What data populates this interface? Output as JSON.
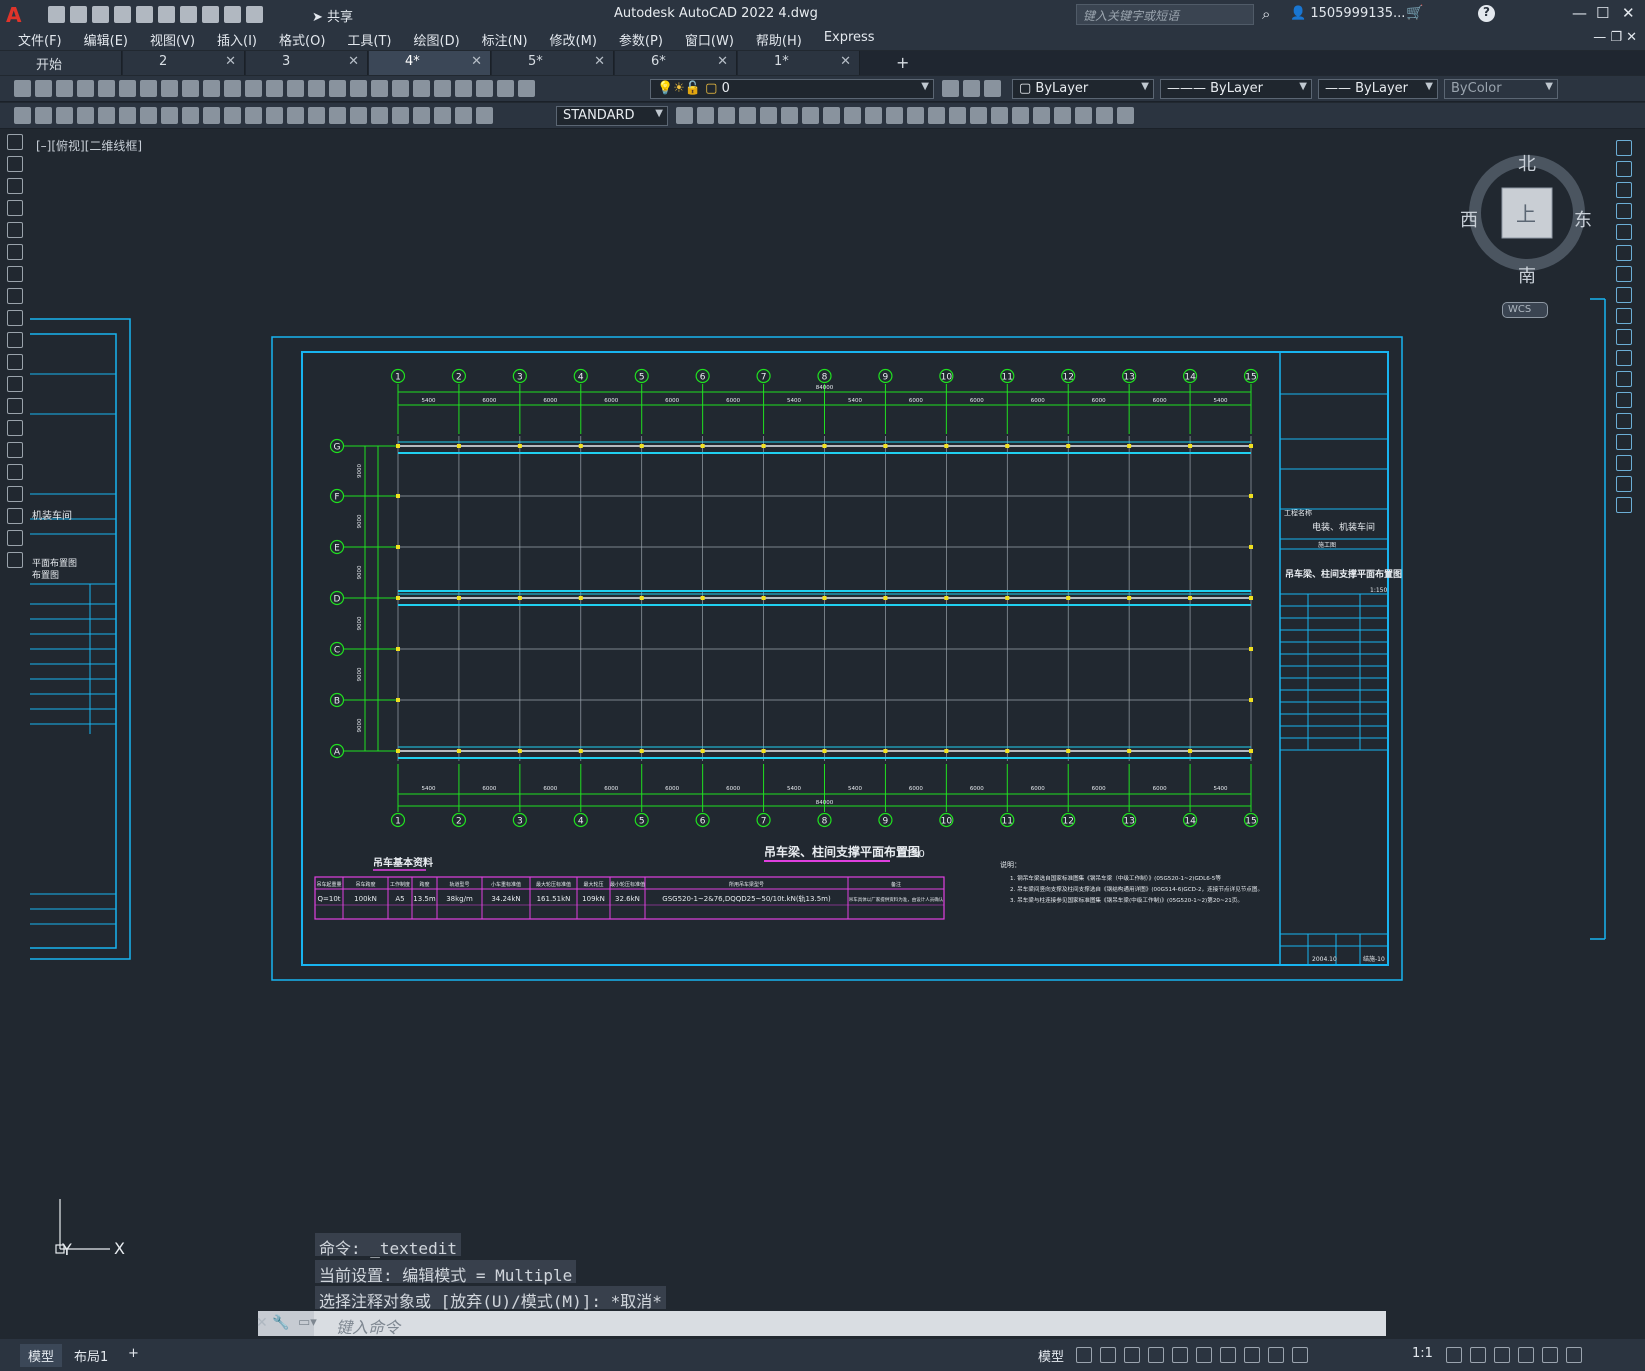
{
  "app": {
    "logo": "A",
    "share": "共享",
    "title": "Autodesk AutoCAD 2022    4.dwg",
    "search_placeholder": "键入关键字或短语",
    "user": "1505999135...",
    "minimize": "—",
    "maximize": "☐",
    "close": "✕"
  },
  "menu": [
    "文件(F)",
    "编辑(E)",
    "视图(V)",
    "插入(I)",
    "格式(O)",
    "工具(T)",
    "绘图(D)",
    "标注(N)",
    "修改(M)",
    "参数(P)",
    "窗口(W)",
    "帮助(H)",
    "Express"
  ],
  "tabs": [
    {
      "label": "开始",
      "close": ""
    },
    {
      "label": "2",
      "close": "✕"
    },
    {
      "label": "3",
      "close": "✕"
    },
    {
      "label": "4*",
      "close": "✕"
    },
    {
      "label": "5*",
      "close": "✕"
    },
    {
      "label": "6*",
      "close": "✕"
    },
    {
      "label": "1*",
      "close": "✕"
    }
  ],
  "tab_add": "+",
  "layers": {
    "current_layer": "0",
    "color": "ByLayer",
    "linetype": "ByLayer",
    "lineweight": "ByLayer",
    "plotstyle": "ByColor"
  },
  "text_style": "STANDARD",
  "view_label": "[–][俯视][二维线框]",
  "compass": {
    "north": "北",
    "south": "南",
    "east": "东",
    "west": "西",
    "top": "上",
    "wcs": "WCS"
  },
  "ucs": {
    "y": "Y",
    "x": "X"
  },
  "drawing": {
    "title": "吊车梁、柱间支撑平面布置图",
    "scale": "1:150",
    "crane_table_title": "吊车基本资料",
    "axes_numbers": [
      "1",
      "2",
      "3",
      "4",
      "5",
      "6",
      "7",
      "8",
      "9",
      "10",
      "11",
      "12",
      "13",
      "14",
      "15"
    ],
    "axes_letters": [
      "G",
      "F",
      "E",
      "D",
      "C",
      "B",
      "A"
    ],
    "spans": [
      "5400",
      "6000",
      "6000",
      "6000",
      "6000",
      "6000",
      "5400",
      "5400",
      "6000",
      "6000",
      "6000",
      "6000",
      "6000",
      "5400"
    ],
    "total_length": "84000",
    "row_spacing": [
      "9000",
      "9000",
      "9000",
      "9000",
      "9000",
      "9000"
    ],
    "crane_headers": [
      "吊车起重量",
      "吊车跨度",
      "工作制度",
      "跨度",
      "轨道型号",
      "小车重标准值",
      "最大轮压标准值",
      "最大轮压",
      "最小轮压标准值",
      "所用吊车梁型号",
      "备注"
    ],
    "crane_values": [
      "Q=10t",
      "100kN",
      "A5",
      "13.5m",
      "38kg/m",
      "34.24kN",
      "161.51kN",
      "109kN",
      "32.6kN",
      "GSG520-1~2&76,DQQD25~50/10t.kN(轨13.5m)",
      "吊车具体以厂家提供资料为准，由设计人员确认"
    ],
    "notes_title": "说明：",
    "notes": [
      "1. 钢吊车梁选自国家标准图集《钢吊车梁（中级工作制）》(05G520-1~2)GDL6-5等",
      "2. 吊车梁间竖向支撑及柱间支撑选自《钢结构通用详图》(00G514-6)GCD-2，连接节点详见节点图。",
      "3. 吊车梁与柱连接参见国家标准图集《钢吊车梁(中级工作制)》(05G520-1~2)第20~21页。"
    ],
    "title_block": {
      "project_label": "工程名称",
      "project": "电装、机装车间",
      "sheet_title": "吊车梁、柱间支撑平面布置图",
      "stage": "施工图",
      "scale": "1:150",
      "date": "2004.10",
      "sheet_no": "结施-10"
    },
    "left_sheet": {
      "project": "机装车间",
      "line1": "平面布置图",
      "line2": "布置图"
    }
  },
  "command": {
    "history": [
      "命令: _textedit",
      "当前设置: 编辑模式 = Multiple",
      "选择注释对象或 [放弃(U)/模式(M)]: *取消*"
    ],
    "prompt": "键入命令"
  },
  "status": {
    "tabs": [
      "模型",
      "布局1"
    ],
    "add": "+",
    "model_btn": "模型",
    "annoscale": "1:1"
  }
}
